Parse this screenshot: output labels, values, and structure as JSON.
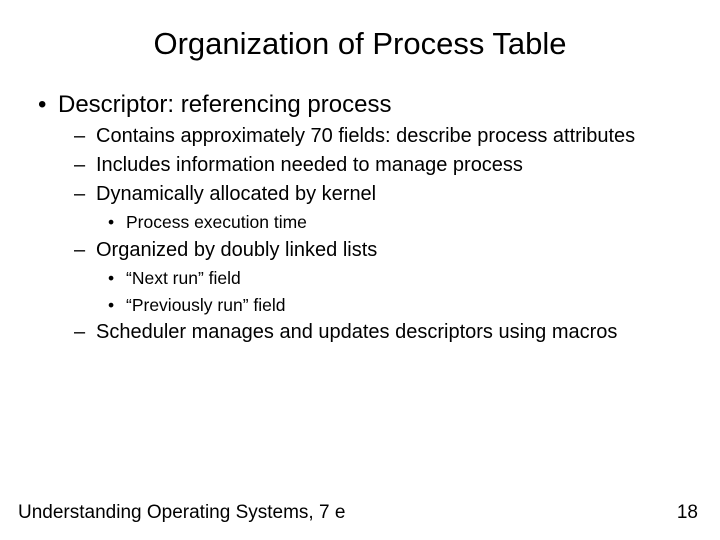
{
  "title": "Organization of Process Table",
  "l1a": "Descriptor: referencing process",
  "l2a": "Contains approximately 70 fields: describe process attributes",
  "l2b": "Includes information needed to manage process",
  "l2c": "Dynamically allocated by kernel",
  "l3a": "Process execution time",
  "l2d": "Organized by doubly linked lists",
  "l3b": "“Next run” field",
  "l3c": "“Previously run” field",
  "l2e": "Scheduler manages and updates descriptors using macros",
  "footer_left": "Understanding Operating Systems, 7 e",
  "footer_right": "18"
}
